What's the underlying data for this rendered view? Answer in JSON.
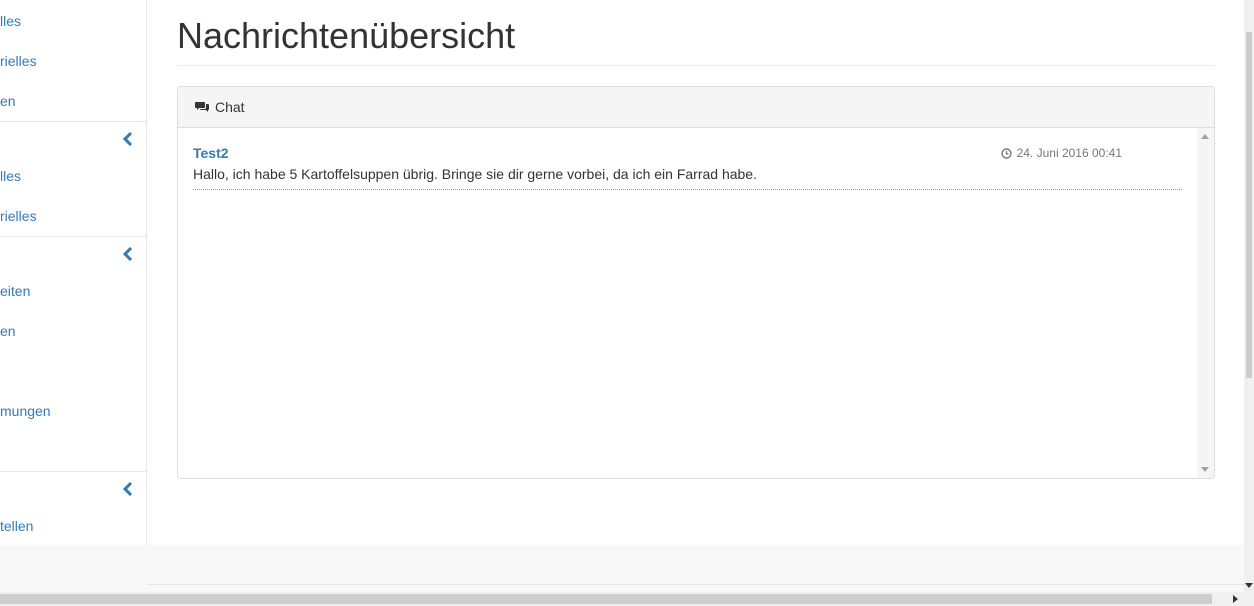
{
  "sidebar": {
    "links": [
      {
        "label": "lles"
      },
      {
        "label": "rielles"
      },
      {
        "label": "en"
      },
      {
        "label": "lles"
      },
      {
        "label": "rielles"
      },
      {
        "label": "eiten"
      },
      {
        "label": "en"
      },
      {
        "label": "mungen"
      },
      {
        "label": "tellen"
      }
    ],
    "toggle_icon": "chevron-left-icon",
    "accent_color": "#337ab7"
  },
  "main": {
    "title": "Nachrichtenübersicht",
    "panel": {
      "heading_icon": "comments-icon",
      "heading": "Chat",
      "messages": [
        {
          "author": "Test2",
          "time_icon": "clock-icon",
          "timestamp": "24. Juni 2016 00:41",
          "text": "Hallo, ich habe 5 Kartoffelsuppen übrig. Bringe sie dir gerne vorbei, da ich ein Farrad habe."
        }
      ]
    }
  }
}
